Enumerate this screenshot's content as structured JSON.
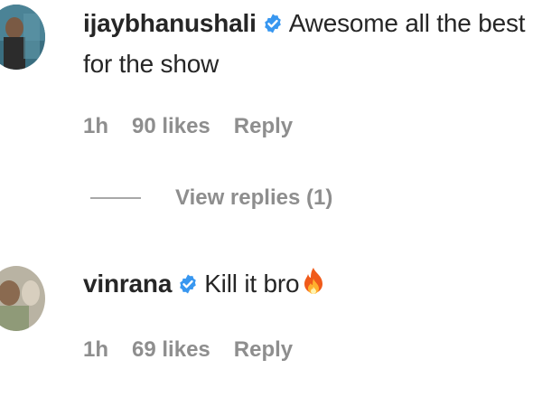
{
  "comments": [
    {
      "username": "ijaybhanushali",
      "text": "Awesome all the best for the show",
      "time": "1h",
      "likes": "90 likes",
      "reply_label": "Reply",
      "view_replies": "View replies (1)"
    },
    {
      "username": "vinrana",
      "text": "Kill it bro",
      "time": "1h",
      "likes": "69 likes",
      "reply_label": "Reply"
    }
  ],
  "icons": {
    "verified": "verified-badge-icon",
    "emoji": "fire-emoji-icon"
  },
  "colors": {
    "verified": "#3897f0",
    "muted": "#8e8e8e",
    "text": "#262626"
  }
}
